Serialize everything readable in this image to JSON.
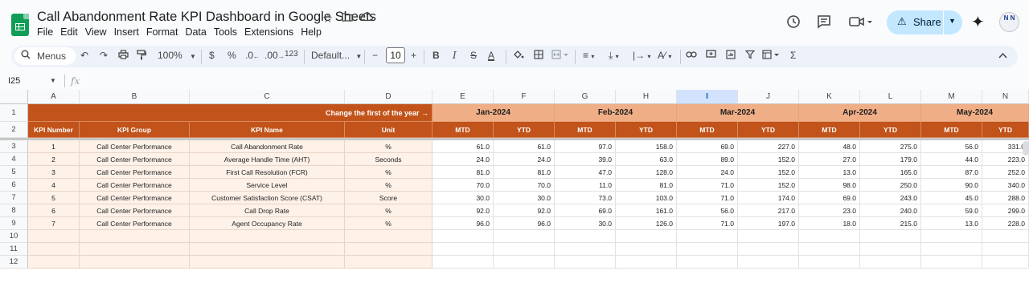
{
  "app": {
    "title": "Call Abandonment Rate KPI Dashboard in Google Sheets",
    "menu": [
      "File",
      "Edit",
      "View",
      "Insert",
      "Format",
      "Data",
      "Tools",
      "Extensions",
      "Help"
    ],
    "share_label": "Share",
    "avatar_text": "N N",
    "brand_color": "#0f9d58",
    "share_color": "#c2e7ff"
  },
  "toolbar": {
    "search_label": "Menus",
    "zoom": "100%",
    "currency": "$",
    "percent": "%",
    "dec_decrease": ".0",
    "dec_increase": ".00",
    "number_format": "123",
    "font": "Default...",
    "font_size": "10",
    "minus": "−",
    "plus": "+",
    "bold": "B",
    "italic": "I",
    "strike": "S",
    "text_color": "A",
    "sigma": "Σ"
  },
  "formula_bar": {
    "cell_ref": "I25",
    "fx": "fx"
  },
  "sheet": {
    "columns": [
      "A",
      "B",
      "C",
      "D",
      "E",
      "F",
      "G",
      "H",
      "I",
      "J",
      "K",
      "L",
      "M",
      "N"
    ],
    "selected_column": "I",
    "row_numbers": [
      "1",
      "2",
      "3",
      "4",
      "5",
      "6",
      "7",
      "8",
      "9",
      "10",
      "11",
      "12"
    ],
    "banner": "Change the first of the year →",
    "months": [
      "Jan-2024",
      "Feb-2024",
      "Mar-2024",
      "Apr-2024",
      "May-2024"
    ],
    "headers": [
      "KPI Number",
      "KPI Group",
      "KPI Name",
      "Unit"
    ],
    "sub_headers": [
      "MTD",
      "YTD",
      "MTD",
      "YTD",
      "MTD",
      "YTD",
      "MTD",
      "YTD",
      "MTD",
      "YTD"
    ],
    "rows": [
      {
        "num": "1",
        "group": "Call Center Performance",
        "name": "Call Abandonment Rate",
        "unit": "%",
        "vals": [
          "61.0",
          "61.0",
          "97.0",
          "158.0",
          "69.0",
          "227.0",
          "48.0",
          "275.0",
          "56.0",
          "331.0"
        ]
      },
      {
        "num": "2",
        "group": "Call Center Performance",
        "name": "Average Handle Time (AHT)",
        "unit": "Seconds",
        "vals": [
          "24.0",
          "24.0",
          "39.0",
          "63.0",
          "89.0",
          "152.0",
          "27.0",
          "179.0",
          "44.0",
          "223.0"
        ]
      },
      {
        "num": "3",
        "group": "Call Center Performance",
        "name": "First Call Resolution (FCR)",
        "unit": "%",
        "vals": [
          "81.0",
          "81.0",
          "47.0",
          "128.0",
          "24.0",
          "152.0",
          "13.0",
          "165.0",
          "87.0",
          "252.0"
        ]
      },
      {
        "num": "4",
        "group": "Call Center Performance",
        "name": "Service Level",
        "unit": "%",
        "vals": [
          "70.0",
          "70.0",
          "11.0",
          "81.0",
          "71.0",
          "152.0",
          "98.0",
          "250.0",
          "90.0",
          "340.0"
        ]
      },
      {
        "num": "5",
        "group": "Call Center Performance",
        "name": "Customer Satisfaction Score (CSAT)",
        "unit": "Score",
        "vals": [
          "30.0",
          "30.0",
          "73.0",
          "103.0",
          "71.0",
          "174.0",
          "69.0",
          "243.0",
          "45.0",
          "288.0"
        ]
      },
      {
        "num": "6",
        "group": "Call Center Performance",
        "name": "Call Drop Rate",
        "unit": "%",
        "vals": [
          "92.0",
          "92.0",
          "69.0",
          "161.0",
          "56.0",
          "217.0",
          "23.0",
          "240.0",
          "59.0",
          "299.0"
        ]
      },
      {
        "num": "7",
        "group": "Call Center Performance",
        "name": "Agent Occupancy Rate",
        "unit": "%",
        "vals": [
          "96.0",
          "96.0",
          "30.0",
          "126.0",
          "71.0",
          "197.0",
          "18.0",
          "215.0",
          "13.0",
          "228.0"
        ]
      }
    ],
    "colors": {
      "dark_header": "#c2531a",
      "light_header": "#f0ae86",
      "body_fill": "#fdf1e8"
    }
  }
}
